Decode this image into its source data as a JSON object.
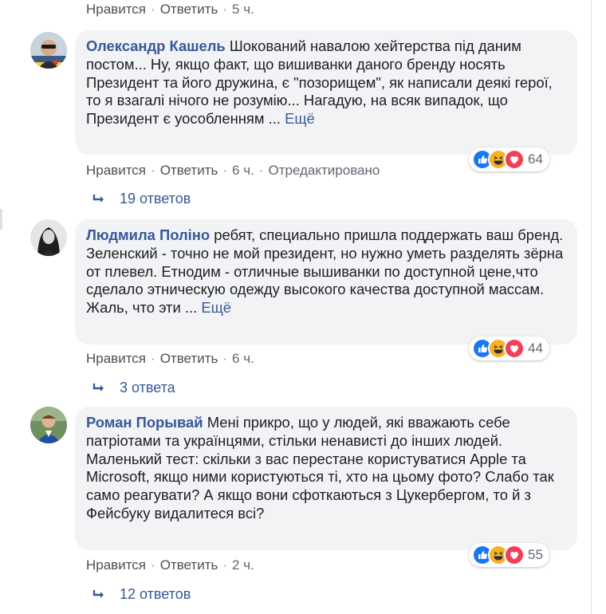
{
  "top_actions": {
    "like": "Нравится",
    "reply": "Ответить",
    "time": "5 ч."
  },
  "comments": [
    {
      "author": "Олександр Кашель",
      "text": " Шокований навалою хейтерства під даним постом... Ну, якщо факт, що вишиванки даного бренду носять Президент та його дружина, є \"позорищем\", як написали деякі герої, то я взагалі нічого не розумію... Нагадую, на всяк випадок, що Президент є уособленням ... ",
      "more": "Ещё",
      "like": "Нравится",
      "reply": "Ответить",
      "time": "6 ч.",
      "edited": "Отредактировано",
      "reaction_count": "64",
      "replies_label": "19 ответов"
    },
    {
      "author": "Людмила Поліно",
      "text": " ребят, специально пришла поддержать ваш бренд. Зеленский - точно не мой президент, но нужно уметь разделять зёрна от плевел. Етнодим - отличные вышиванки по доступной цене,что сделало этническую одежду высокого качества доступной массам. Жаль, что эти ... ",
      "more": "Ещё",
      "like": "Нравится",
      "reply": "Ответить",
      "time": "6 ч.",
      "reaction_count": "44",
      "replies_label": "3 ответа"
    },
    {
      "author": "Роман Порывай",
      "text": " Мені прикро, що у людей, які вважають себе патріотами та українцями, стільки ненависті до інших людей. Маленький тест: скільки з вас перестане користуватися Apple та Microsoft, якщо ними користуються ті, хто на цьому фото? Слабо так само реагувати? А якщо вони сфоткаються з Цукербергом, то й з Фейсбуку видалитеся всі?",
      "like": "Нравится",
      "reply": "Ответить",
      "time": "2 ч.",
      "reaction_count": "55",
      "replies_label": "12 ответов"
    }
  ],
  "colors": {
    "link": "#385898",
    "bubble": "#f2f3f5",
    "meta": "#606770",
    "like_blue": "#1877f2",
    "haha_yellow": "#f7b125",
    "love_red": "#f33e58"
  },
  "icons": [
    "like-reaction-icon",
    "haha-reaction-icon",
    "love-reaction-icon",
    "reply-arrow-icon"
  ]
}
